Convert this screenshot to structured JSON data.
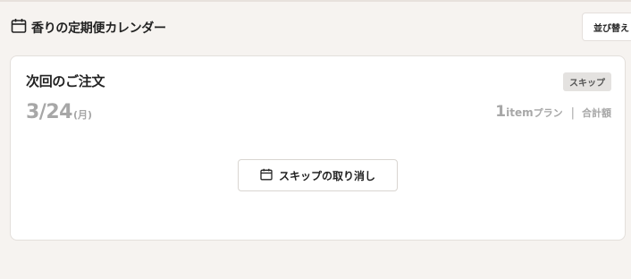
{
  "header": {
    "title": "香りの定期便カレンダー",
    "icon": "calendar-icon",
    "sort_label": "並び替え"
  },
  "order": {
    "title": "次回のご注文",
    "status_badge": "スキップ",
    "date": "3/24",
    "weekday": "(月)",
    "plan_count": "1",
    "plan_unit": "item",
    "plan_suffix": "プラン",
    "separator": "|",
    "total_label": "合計額",
    "unskip_label": "スキップの取り消し",
    "unskip_icon": "calendar-icon"
  },
  "colors": {
    "background": "#f6f3f0",
    "card": "#ffffff",
    "muted_text": "#a7a7a7",
    "badge_bg": "#e4e2e0"
  }
}
